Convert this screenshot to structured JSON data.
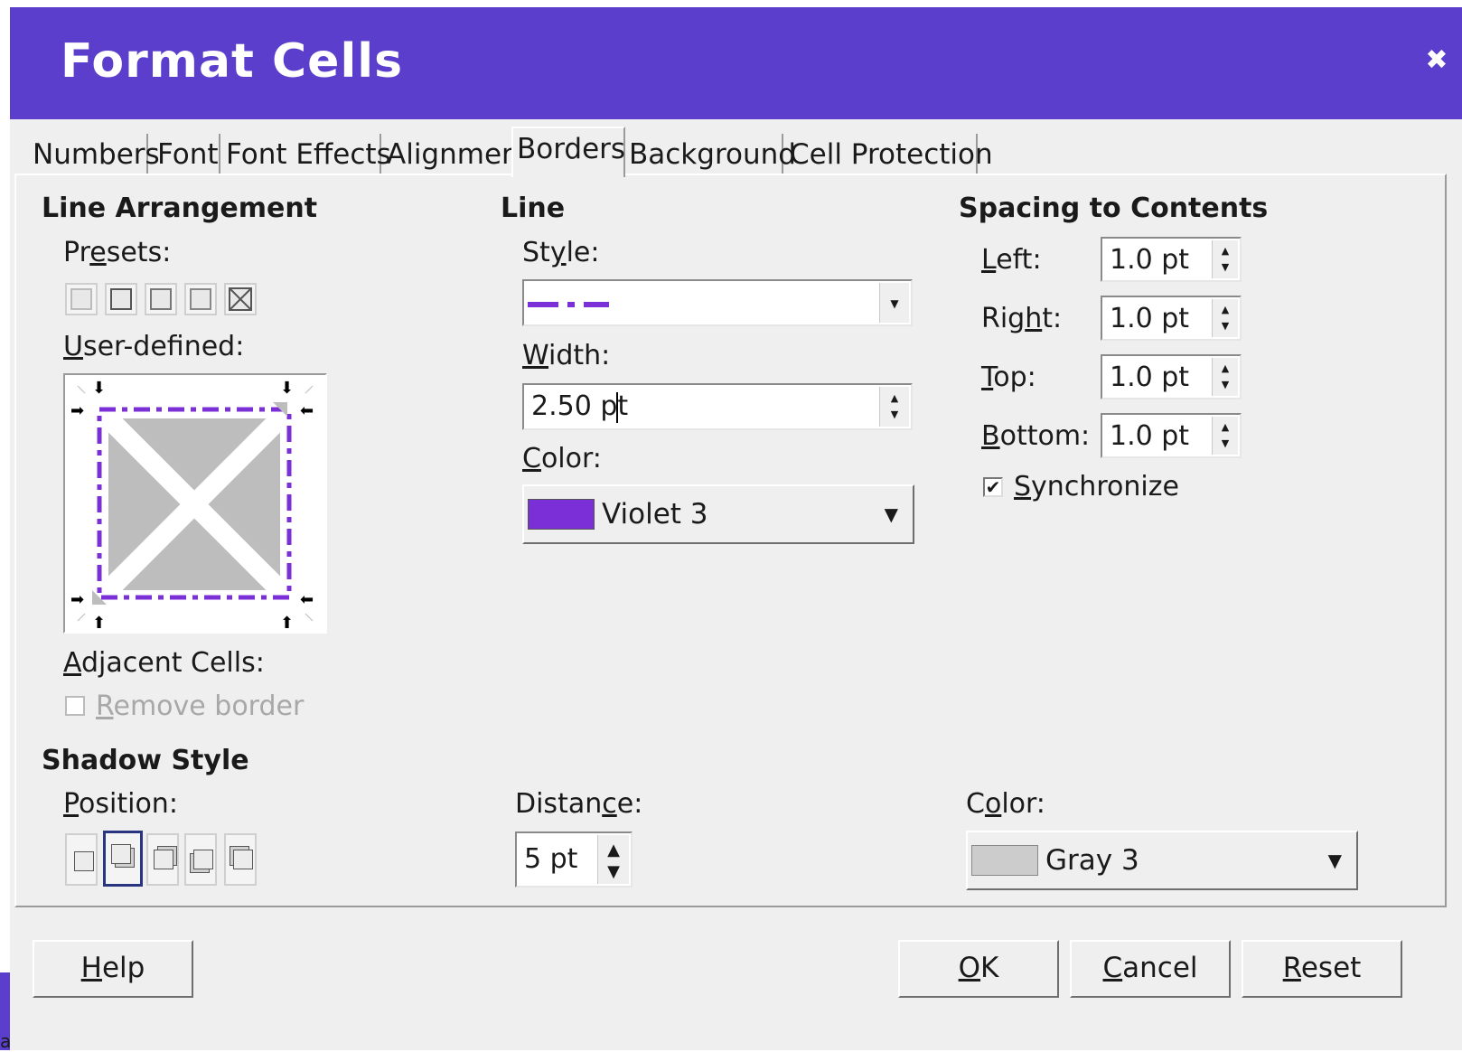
{
  "dialog": {
    "title": "Format Cells",
    "close_glyph": "✖",
    "colors": {
      "titlebar": "#5b3fcc",
      "line_color": "#7b2fd6",
      "shadow_color": "#cccccc"
    }
  },
  "background_text": "a",
  "tabs": [
    {
      "label": "Numbers",
      "active": false
    },
    {
      "label": "Font",
      "active": false
    },
    {
      "label": "Font Effects",
      "active": false
    },
    {
      "label": "Alignment",
      "active": false
    },
    {
      "label": "Borders",
      "active": true
    },
    {
      "label": "Background",
      "active": false
    },
    {
      "label": "Cell Protection",
      "active": false
    }
  ],
  "line_arrangement": {
    "title": "Line Arrangement",
    "presets_label": "Presets:",
    "user_defined_label": "User-defined:",
    "adjacent_cells_label": "Adjacent Cells:",
    "remove_border_label": "Remove border",
    "remove_border_checked": false
  },
  "line": {
    "title": "Line",
    "style_label": "Style:",
    "width_label": "Width:",
    "width_value": "2.50 pt",
    "color_label": "Color:",
    "color_value": "Violet 3"
  },
  "spacing": {
    "title": "Spacing to Contents",
    "left_label": "Left:",
    "left_value": "1.0 pt",
    "right_label": "Right:",
    "right_value": "1.0 pt",
    "top_label": "Top:",
    "top_value": "1.0 pt",
    "bottom_label": "Bottom:",
    "bottom_value": "1.0 pt",
    "synchronize_label": "Synchronize",
    "synchronize_checked": true
  },
  "shadow": {
    "title": "Shadow Style",
    "position_label": "Position:",
    "distance_label": "Distance:",
    "distance_value": "5 pt",
    "color_label": "Color:",
    "color_value": "Gray 3"
  },
  "buttons": {
    "help": "Help",
    "ok": "OK",
    "cancel": "Cancel",
    "reset": "Reset"
  }
}
